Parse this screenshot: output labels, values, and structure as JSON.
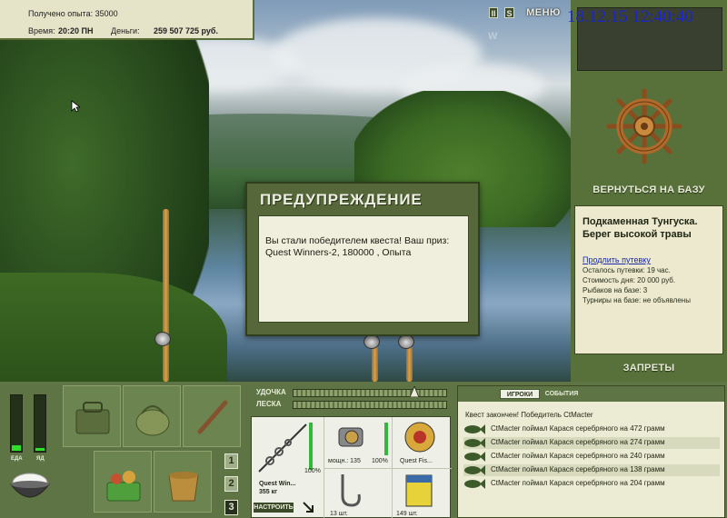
{
  "top_info": {
    "exp_line": "Получено опыта: 35000",
    "time_label": "Время:",
    "time_value": "20:20 ПН",
    "money_label": "Деньги:",
    "money_value": "259 507 725 руб."
  },
  "controls": {
    "pause_label": "II",
    "sound_label": "S",
    "menu_label": "МЕНЮ"
  },
  "watermark": "W",
  "clock": "18.12.15 12:40:40",
  "right_panel": {
    "return_label": "ВЕРНУТЬСЯ НА БАЗУ",
    "location_title": "Подкаменная Тунгуска. Берег высокой травы",
    "extend_link": "Продлить путевку",
    "info_lines": [
      "Осталось путевки: 19 час.",
      "Стоимость дня: 20 000 руб.",
      "Рыбаков на базе: 3",
      "Турниры на базе: не объявлены"
    ],
    "bans_label": "ЗАПРЕТЫ"
  },
  "dialog": {
    "title": "ПРЕДУПРЕЖДЕНИЕ",
    "message": "Вы стали победителем квеста! Ваш приз: Quest Winners-2, 180000 , Опыта"
  },
  "status_bars": {
    "food_label": "ЕДА",
    "poison_label": "ЯД",
    "food_level": 0.1,
    "poison_level": 0.05
  },
  "inventory_pages": [
    "1",
    "2",
    "3"
  ],
  "active_page": "3",
  "tackle": {
    "rod_label": "УДОЧКА",
    "line_label": "ЛЕСКА",
    "rod_name": "Quest Win...",
    "rod_weight": "355 кг",
    "rod_percent": "100%",
    "reel_power": "мощн.: 135",
    "reel_percent": "100%",
    "line_name": "Quest Fis...",
    "hooks_count": "13 шт.",
    "bait_count": "149 шт.",
    "setup_label": "НАСТРОИТЬ"
  },
  "events": {
    "tab_players": "ИГРОКИ",
    "tab_events": "СОБЫТИЯ",
    "quest_line": "Квест закончен! Победитель CtMacter",
    "rows": [
      "CtMacter поймал Карася серебряного на 472 грамм",
      "CtMacter поймал Карася серебряного на 274 грамм",
      "CtMacter поймал Карася серебряного на 240 грамм",
      "CtMacter поймал Карася серебряного на 138 грамм",
      "CtMacter поймал Карася серебряного на 204 грамм"
    ]
  },
  "colors": {
    "panel_green": "#58703a",
    "dialog_green": "#56683a",
    "parchment": "#ecebd3",
    "clock_blue": "#1a26c8",
    "bar_green": "#2ddf2a"
  }
}
